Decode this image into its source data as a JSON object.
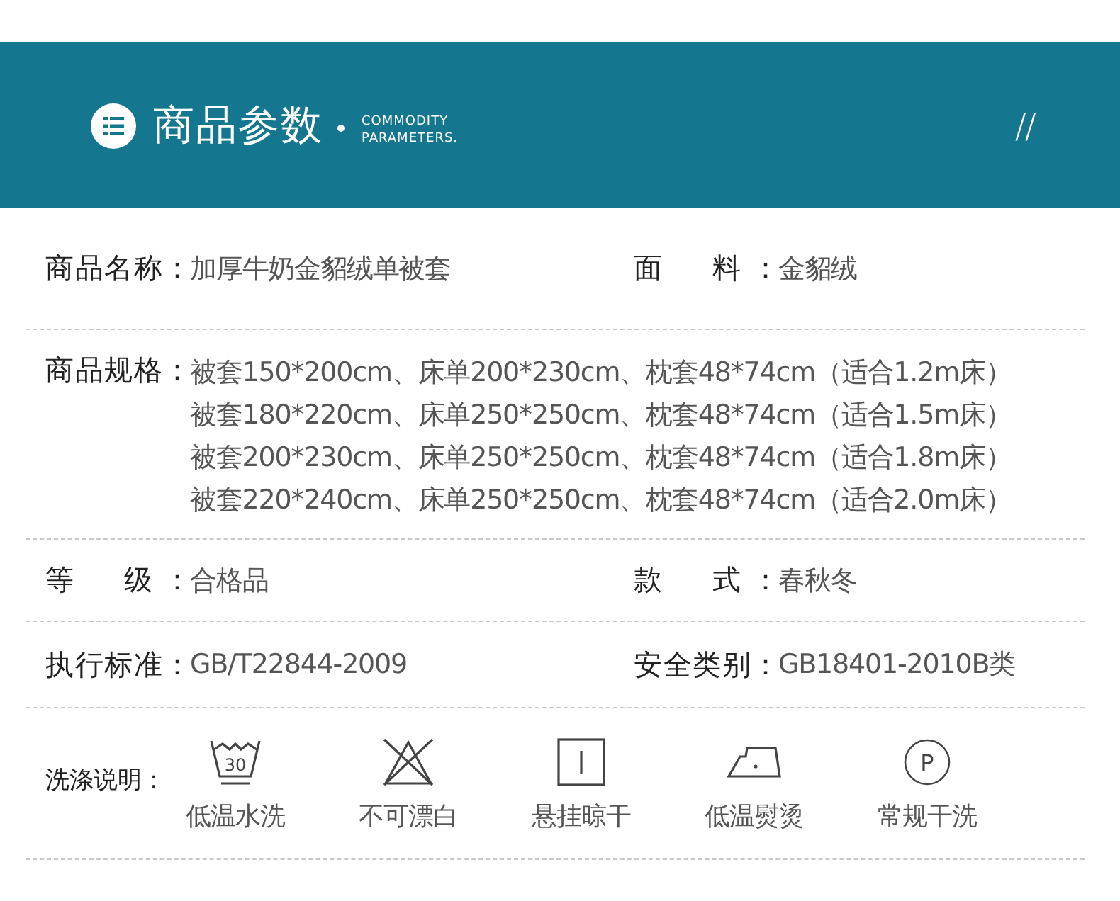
{
  "header": {
    "title": "商品参数",
    "subtitle_lines": [
      "COMMODITY",
      "PARAMETERS."
    ],
    "mark": "//"
  },
  "rows": [
    {
      "kind": "pair",
      "items": [
        {
          "label": "商品名称：",
          "value": "加厚牛奶金貂绒单被套"
        },
        {
          "label": "面　料：",
          "value": "金貂绒"
        }
      ]
    },
    {
      "kind": "multi",
      "label": "商品规格：",
      "lines": [
        "被套150*200cm、床单200*230cm、枕套48*74cm（适合1.2m床）",
        "被套180*220cm、床单250*250cm、枕套48*74cm（适合1.5m床）",
        "被套200*230cm、床单250*250cm、枕套48*74cm（适合1.8m床）",
        "被套220*240cm、床单250*250cm、枕套48*74cm（适合2.0m床）"
      ]
    },
    {
      "kind": "pair",
      "items": [
        {
          "label": "等　级：",
          "value": "合格品"
        },
        {
          "label": "款　式：",
          "value": "春秋冬"
        }
      ]
    },
    {
      "kind": "pair",
      "items": [
        {
          "label": "执行标准：",
          "value": "GB/T22844-2009"
        },
        {
          "label": "安全类别：",
          "value": "GB18401-2010B类"
        }
      ]
    },
    {
      "kind": "care",
      "label": "洗涤说明：",
      "items": [
        {
          "kind": "wash",
          "symbol": "30",
          "label": "低温水洗"
        },
        {
          "kind": "no-bleach",
          "label": "不可漂白"
        },
        {
          "kind": "hang-dry",
          "label": "悬挂晾干"
        },
        {
          "kind": "iron",
          "label": "低温熨烫"
        },
        {
          "kind": "dry-clean",
          "symbol": "P",
          "label": "常规干洗"
        }
      ]
    }
  ]
}
